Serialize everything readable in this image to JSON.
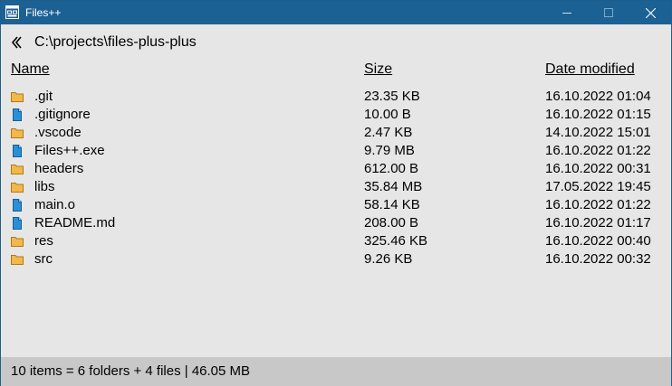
{
  "window": {
    "title": "Files++",
    "colors": {
      "titlebar": "#1c6193",
      "folder": "#f2b84b",
      "file": "#2b8fd6",
      "statusbar": "#c8c8c8"
    }
  },
  "path": {
    "current": "C:\\projects\\files-plus-plus"
  },
  "columns": {
    "name": "Name",
    "size": "Size",
    "date": "Date modified"
  },
  "entries": [
    {
      "name": ".git",
      "size": "23.35 KB",
      "date": "16.10.2022 01:04",
      "type": "folder"
    },
    {
      "name": ".gitignore",
      "size": "10.00 B",
      "date": "16.10.2022 01:15",
      "type": "file"
    },
    {
      "name": ".vscode",
      "size": "2.47 KB",
      "date": "14.10.2022 15:01",
      "type": "folder"
    },
    {
      "name": "Files++.exe",
      "size": "9.79 MB",
      "date": "16.10.2022 01:22",
      "type": "file"
    },
    {
      "name": "headers",
      "size": "612.00 B",
      "date": "16.10.2022 00:31",
      "type": "folder"
    },
    {
      "name": "libs",
      "size": "35.84 MB",
      "date": "17.05.2022 19:45",
      "type": "folder"
    },
    {
      "name": "main.o",
      "size": "58.14 KB",
      "date": "16.10.2022 01:22",
      "type": "file"
    },
    {
      "name": "README.md",
      "size": "208.00 B",
      "date": "16.10.2022 01:17",
      "type": "file"
    },
    {
      "name": "res",
      "size": "325.46 KB",
      "date": "16.10.2022 00:40",
      "type": "folder"
    },
    {
      "name": "src",
      "size": "9.26 KB",
      "date": "16.10.2022 00:32",
      "type": "folder"
    }
  ],
  "status": {
    "summary": "10 items = 6 folders + 4 files | 46.05 MB"
  }
}
